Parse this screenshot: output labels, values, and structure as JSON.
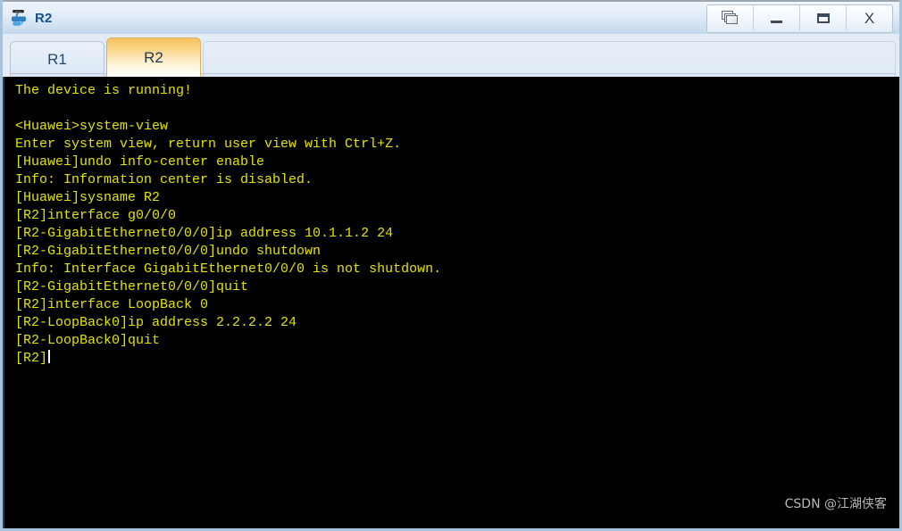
{
  "window": {
    "title": "R2",
    "app_icon": "router-icon",
    "controls": [
      {
        "name": "cascade-windows-button",
        "label": "❐",
        "icon": "cascade-windows-icon"
      },
      {
        "name": "minimize-button",
        "label": "–",
        "icon": "minimize-icon"
      },
      {
        "name": "maximize-button",
        "label": "▭",
        "icon": "maximize-icon"
      },
      {
        "name": "close-button",
        "label": "X",
        "icon": "close-icon"
      }
    ]
  },
  "tabs": [
    {
      "label": "R1",
      "active": false
    },
    {
      "label": "R2",
      "active": true
    }
  ],
  "terminal": {
    "foreground_color": "#e3e300",
    "background_color": "#000000",
    "cursor_color": "#ffffff",
    "lines": [
      "The device is running!",
      "",
      "<Huawei>system-view",
      "Enter system view, return user view with Ctrl+Z.",
      "[Huawei]undo info-center enable",
      "Info: Information center is disabled.",
      "[Huawei]sysname R2",
      "[R2]interface g0/0/0",
      "[R2-GigabitEthernet0/0/0]ip address 10.1.1.2 24",
      "[R2-GigabitEthernet0/0/0]undo shutdown",
      "Info: Interface GigabitEthernet0/0/0 is not shutdown.",
      "[R2-GigabitEthernet0/0/0]quit",
      "[R2]interface LoopBack 0",
      "[R2-LoopBack0]ip address 2.2.2.2 24",
      "[R2-LoopBack0]quit"
    ],
    "prompt": "[R2]"
  },
  "watermark": {
    "text": "CSDN @江湖侠客"
  }
}
